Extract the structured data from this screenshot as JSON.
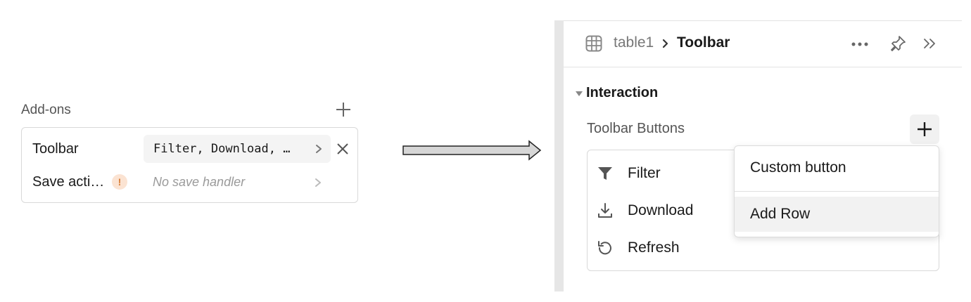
{
  "addons": {
    "title": "Add-ons",
    "rows": [
      {
        "label": "Toolbar",
        "value": "Filter, Download, …"
      },
      {
        "label": "Save acti…",
        "warning": "!",
        "placeholder": "No save handler"
      }
    ]
  },
  "inspector": {
    "breadcrumb": {
      "parent": "table1",
      "current": "Toolbar"
    },
    "section": {
      "title": "Interaction"
    },
    "toolbar_buttons": {
      "label": "Toolbar Buttons",
      "items": [
        {
          "label": "Filter",
          "icon": "filter-icon"
        },
        {
          "label": "Download",
          "icon": "download-icon"
        },
        {
          "label": "Refresh",
          "icon": "refresh-icon"
        }
      ]
    },
    "add_menu": {
      "items": [
        {
          "label": "Custom button"
        },
        {
          "label": "Add Row",
          "highlighted": true
        }
      ]
    }
  },
  "colors": {
    "warning_bg": "#fbe3d2",
    "warning_fg": "#d9803b",
    "gutter": "#e6e6e6",
    "muted_text": "#777777"
  }
}
